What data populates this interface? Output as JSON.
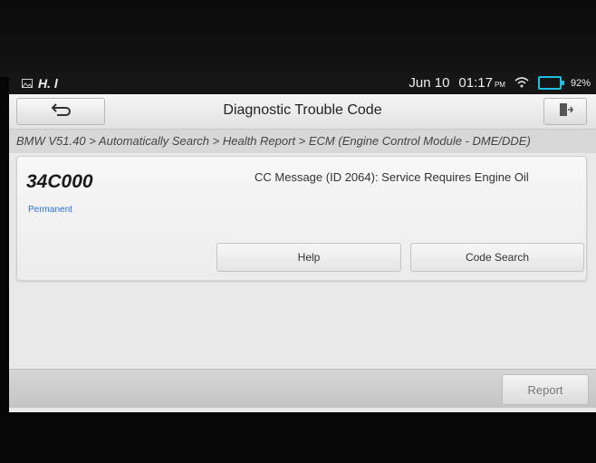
{
  "statusbar": {
    "left_text": "H. l",
    "date": "Jun 10",
    "time": "01:17",
    "ampm": "PM",
    "battery": "92%",
    "icons": [
      "image-icon",
      "wifi-icon",
      "battery-icon"
    ]
  },
  "header": {
    "title": "Diagnostic Trouble Code",
    "back_icon": "back-arrow-icon",
    "exit_icon": "exit-icon"
  },
  "breadcrumb": "BMW V51.40 > Automatically Search > Health Report > ECM (Engine Control Module - DME/DDE)",
  "dtc": {
    "code": "34C000",
    "status": "Permanent",
    "description": "CC Message (ID 2064): Service Requires Engine Oil",
    "help_label": "Help",
    "code_search_label": "Code Search"
  },
  "footer": {
    "report_label": "Report"
  },
  "colors": {
    "status_link": "#2a6fd0",
    "battery": "#1ec0e0"
  }
}
